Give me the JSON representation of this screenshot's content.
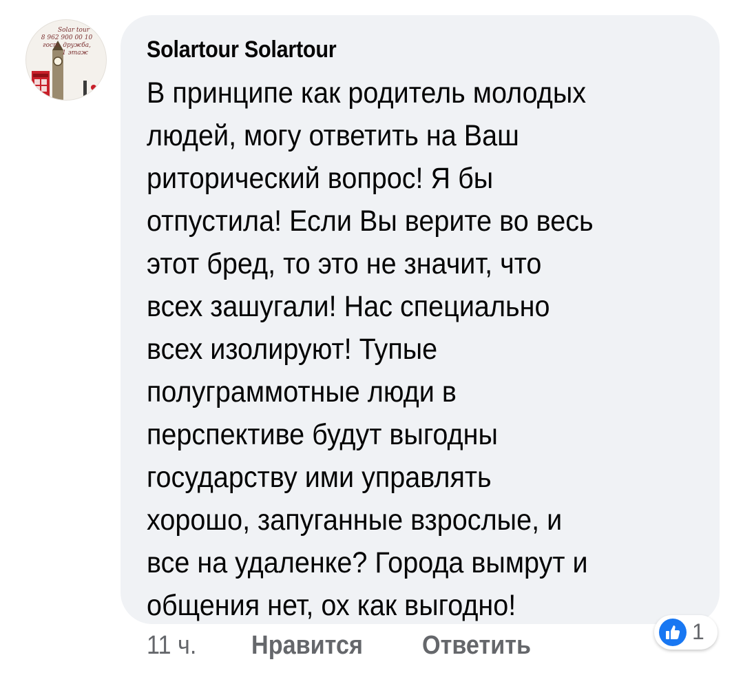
{
  "comment": {
    "author": "Solartour Solartour",
    "avatar_text": [
      "Solar tour",
      "8 962 900 00 10",
      "гост. дружба,",
      "1 этаж"
    ],
    "body_lines": [
      "В принципе как родитель молодых",
      "людей, могу ответить на Ваш",
      "риторический вопрос!  Я бы",
      "отпустила! Если Вы верите во весь",
      "этот бред, то это не значит, что",
      "всех зашугали! Нас специально",
      "всех изолируют! Тупые",
      "полуграммотные люди в",
      "перспективе будут выгодны",
      "государству ими управлять",
      "хорошо, запуганные взрослые, и",
      "все на удаленке? Города вымрут и",
      "общения нет, ох как выгодно!"
    ]
  },
  "actions": {
    "time": "11 ч.",
    "like_label": "Нравится",
    "reply_label": "Ответить"
  },
  "reactions": {
    "icon": "thumbs-up-icon",
    "count": "1",
    "color": "#1877f2"
  }
}
